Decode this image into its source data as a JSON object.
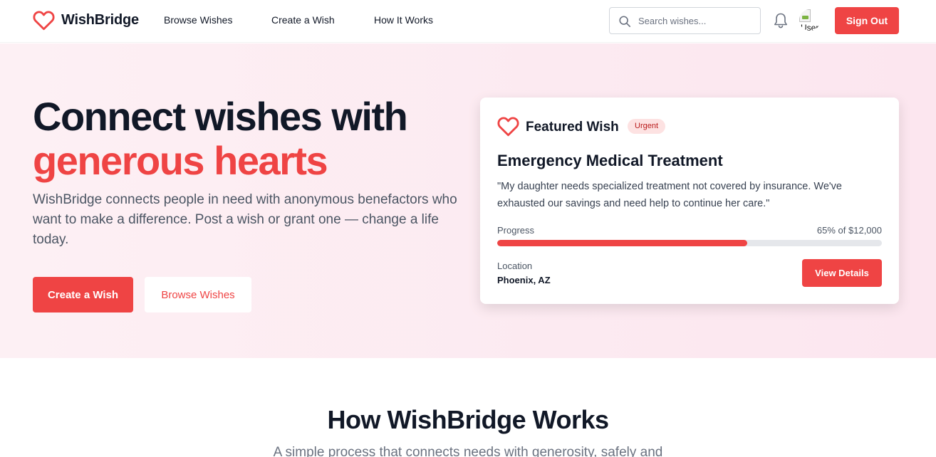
{
  "brand": {
    "name": "WishBridge",
    "accent": "#ef4444"
  },
  "nav": {
    "links": [
      "Browse Wishes",
      "Create a Wish",
      "How It Works"
    ],
    "search_placeholder": "Search wishes...",
    "bell_icon": "bell-icon",
    "avatar_alt": "User",
    "sign_out_label": "Sign Out"
  },
  "hero": {
    "title_line1": "Connect wishes with",
    "title_line2": "generous hearts",
    "subtitle": "WishBridge connects people in need with anonymous benefactors who want to make a difference. Post a wish or grant one — change a life today.",
    "primary_cta": "Create a Wish",
    "secondary_cta": "Browse Wishes"
  },
  "featured": {
    "label": "Featured Wish",
    "badge": "Urgent",
    "title": "Emergency Medical Treatment",
    "quote": "\"My daughter needs specialized treatment not covered by insurance. We've exhausted our savings and need help to continue her care.\"",
    "progress_label": "Progress",
    "progress_text": "65% of $12,000",
    "progress_fraction": 0.65,
    "location_label": "Location",
    "location_value": "Phoenix, AZ",
    "details_button": "View Details"
  },
  "how": {
    "title": "How WishBridge Works",
    "subtitle": "A simple process that connects needs with generosity, safely and"
  }
}
